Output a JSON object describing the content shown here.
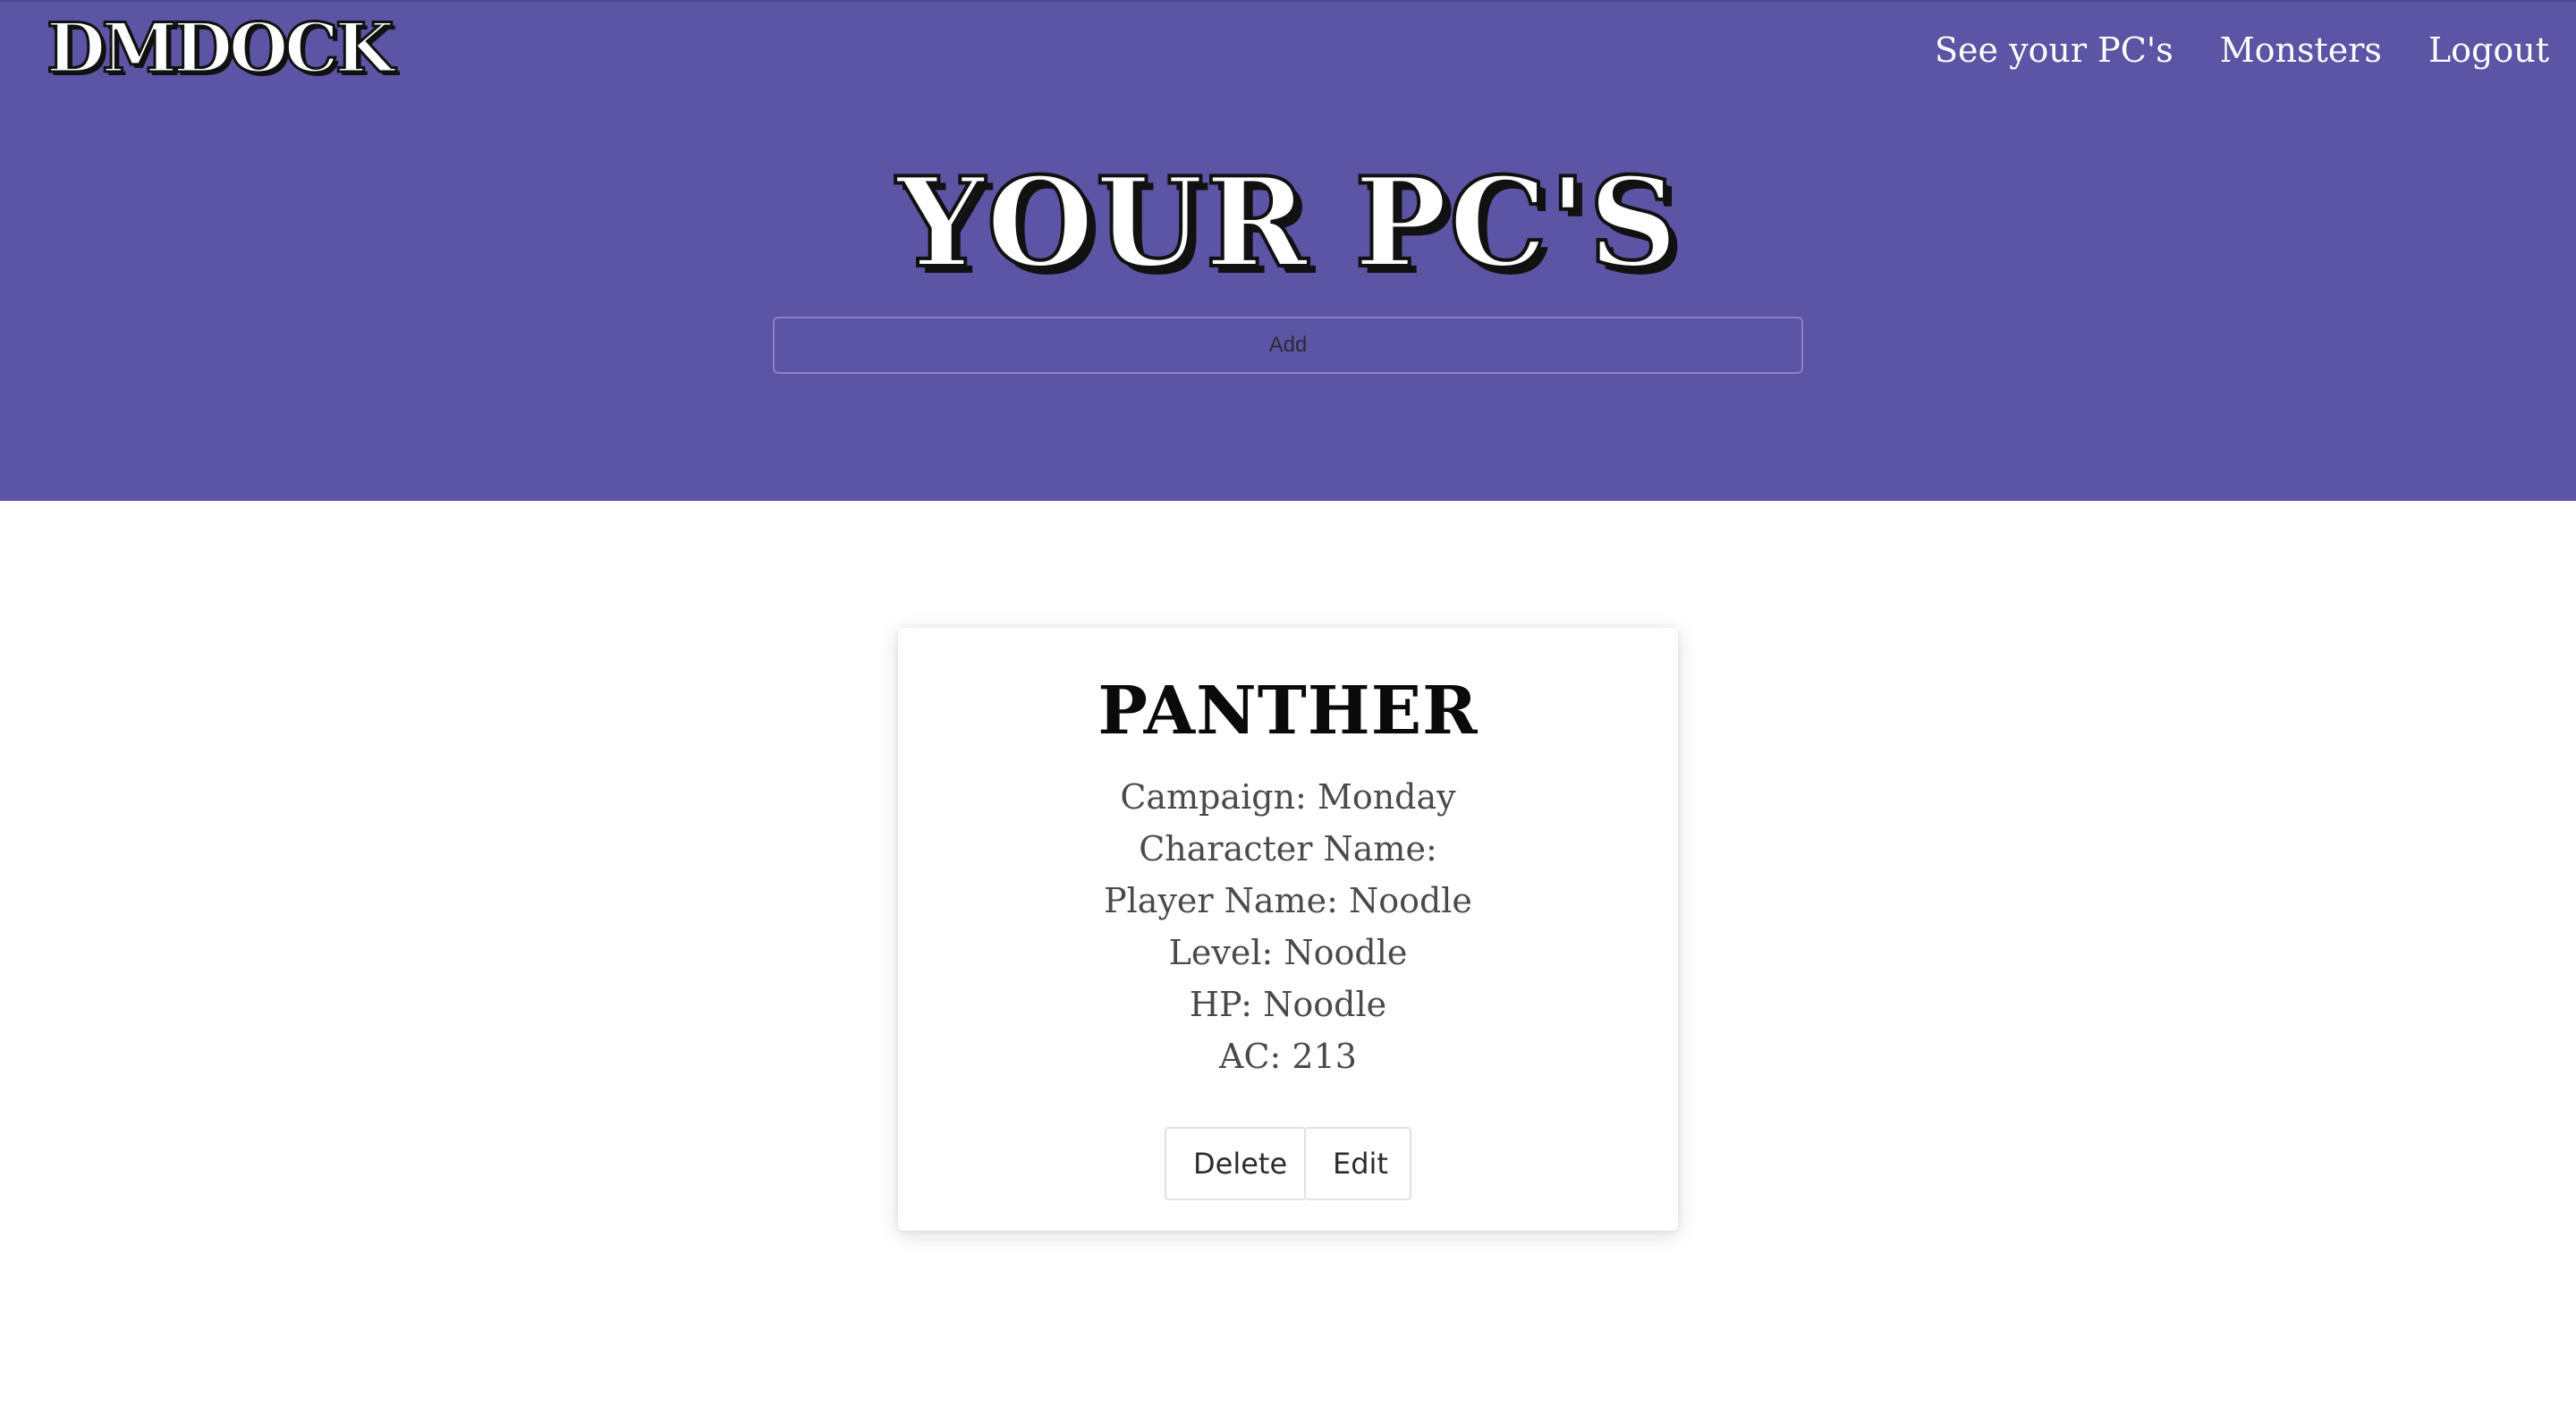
{
  "header": {
    "logo": "DMDOCK",
    "nav": [
      {
        "label": "See your PC's"
      },
      {
        "label": "Monsters"
      },
      {
        "label": "Logout"
      }
    ],
    "page_title": "YOUR PC'S",
    "add_label": "Add",
    "background_color": "#5c54a4"
  },
  "card": {
    "title": "PANTHER",
    "details": [
      "Campaign: Monday",
      "Character Name:",
      "Player Name: Noodle",
      "Level: Noodle",
      "HP: Noodle",
      "AC: 213"
    ],
    "actions": {
      "delete_label": "Delete",
      "edit_label": "Edit"
    }
  }
}
